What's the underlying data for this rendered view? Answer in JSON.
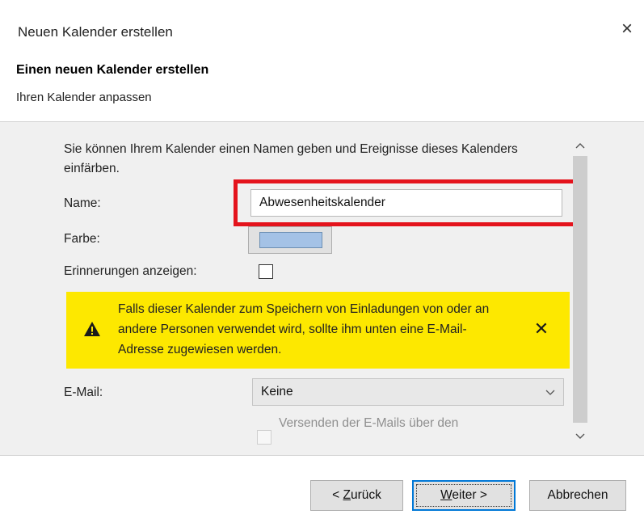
{
  "window": {
    "title": "Neuen Kalender erstellen",
    "close_label": "×"
  },
  "header": {
    "title": "Einen neuen Kalender erstellen",
    "subtitle": "Ihren Kalender anpassen"
  },
  "content": {
    "intro": "Sie können Ihrem Kalender einen Namen geben und Ereignisse dieses Kalenders einfärben.",
    "name_label": "Name:",
    "name_value": "Abwesenheitskalender",
    "color_label": "Farbe:",
    "color_value": "#a4c2e6",
    "reminders_label": "Erinnerungen anzeigen:",
    "reminders_checked": false,
    "warning_text": "Falls dieser Kalender zum Speichern von Einladungen von oder an andere Personen verwendet wird, sollte ihm unten eine E-Mail-Adresse zugewiesen werden.",
    "warning_close": "✕",
    "email_label": "E-Mail:",
    "email_value": "Keine",
    "send_label": "Versenden der E-Mails über den"
  },
  "buttons": {
    "back_prefix": "< ",
    "back_accel": "Z",
    "back_rest": "urück",
    "next_accel": "W",
    "next_rest": "eiter >",
    "cancel": "Abbrechen"
  },
  "colors": {
    "highlight": "#e4131c",
    "warning_bg": "#fde800",
    "focus": "#0078d7"
  }
}
